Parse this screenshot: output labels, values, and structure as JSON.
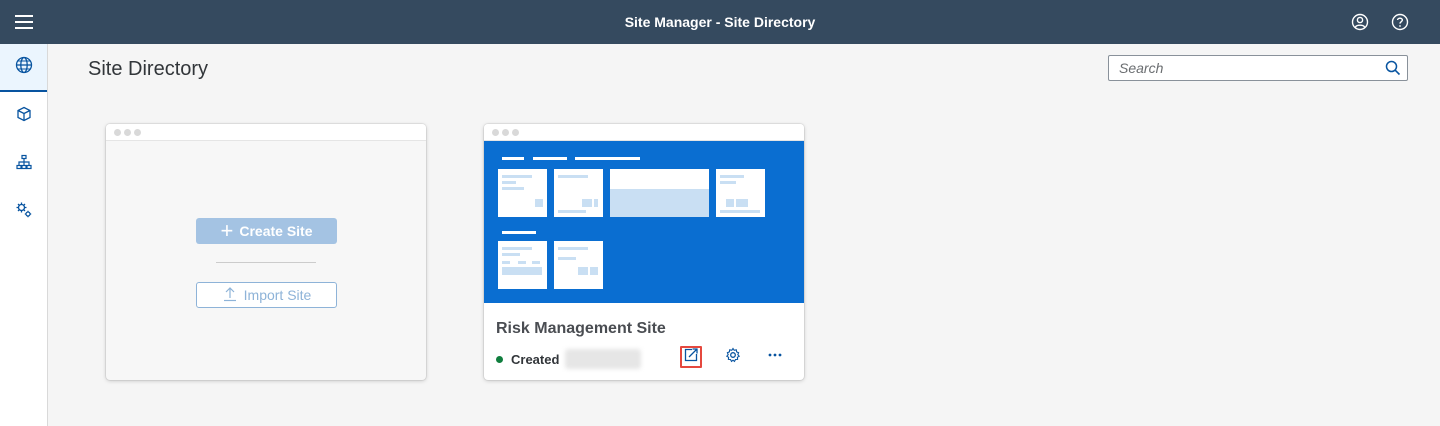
{
  "shell": {
    "title": "Site Manager - Site Directory"
  },
  "page": {
    "title": "Site Directory"
  },
  "search": {
    "placeholder": "Search"
  },
  "create_card": {
    "create_label": "Create Site",
    "import_label": "Import Site"
  },
  "site_card": {
    "name": "Risk Management Site",
    "status": "Created"
  },
  "colors": {
    "shell": "#354a5f",
    "accent": "#0a6ed1",
    "status_ok": "#107e3e",
    "highlight": "#e5483e"
  }
}
